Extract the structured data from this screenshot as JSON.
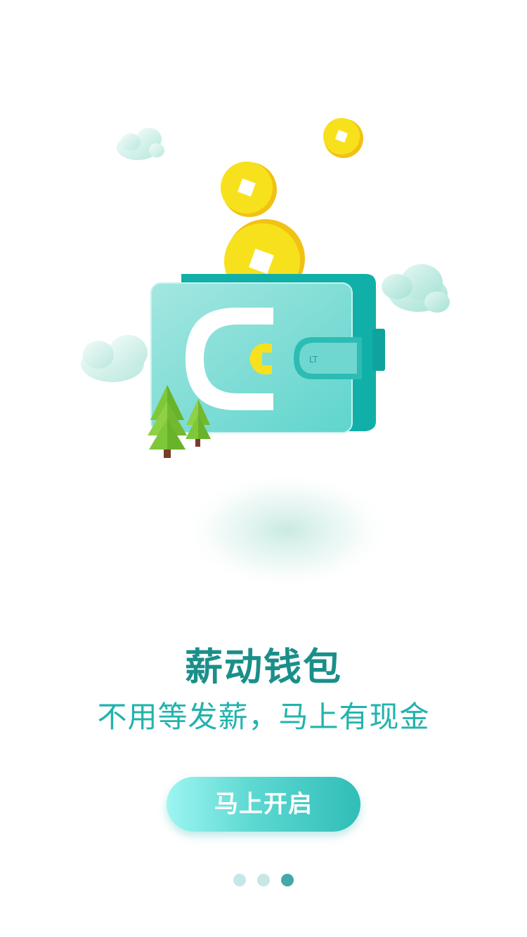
{
  "onboarding": {
    "title": "薪动钱包",
    "subtitle": "不用等发薪，马上有现金",
    "start_button_label": "马上开启",
    "pager": {
      "total": 3,
      "current": 3
    }
  },
  "colors": {
    "title": "#1a8f8a",
    "subtitle": "#22b3ac",
    "button_gradient_start": "#9df5f1",
    "button_gradient_end": "#31bdb8",
    "wallet_face": "#74dad4",
    "wallet_back": "#10b0a8",
    "coin": "#f7e11c",
    "pager_inactive": "#c9e6e6",
    "pager_active": "#43a9a6"
  },
  "icons": [
    "wallet-icon",
    "coin-icon",
    "cloud-icon",
    "tree-icon"
  ]
}
